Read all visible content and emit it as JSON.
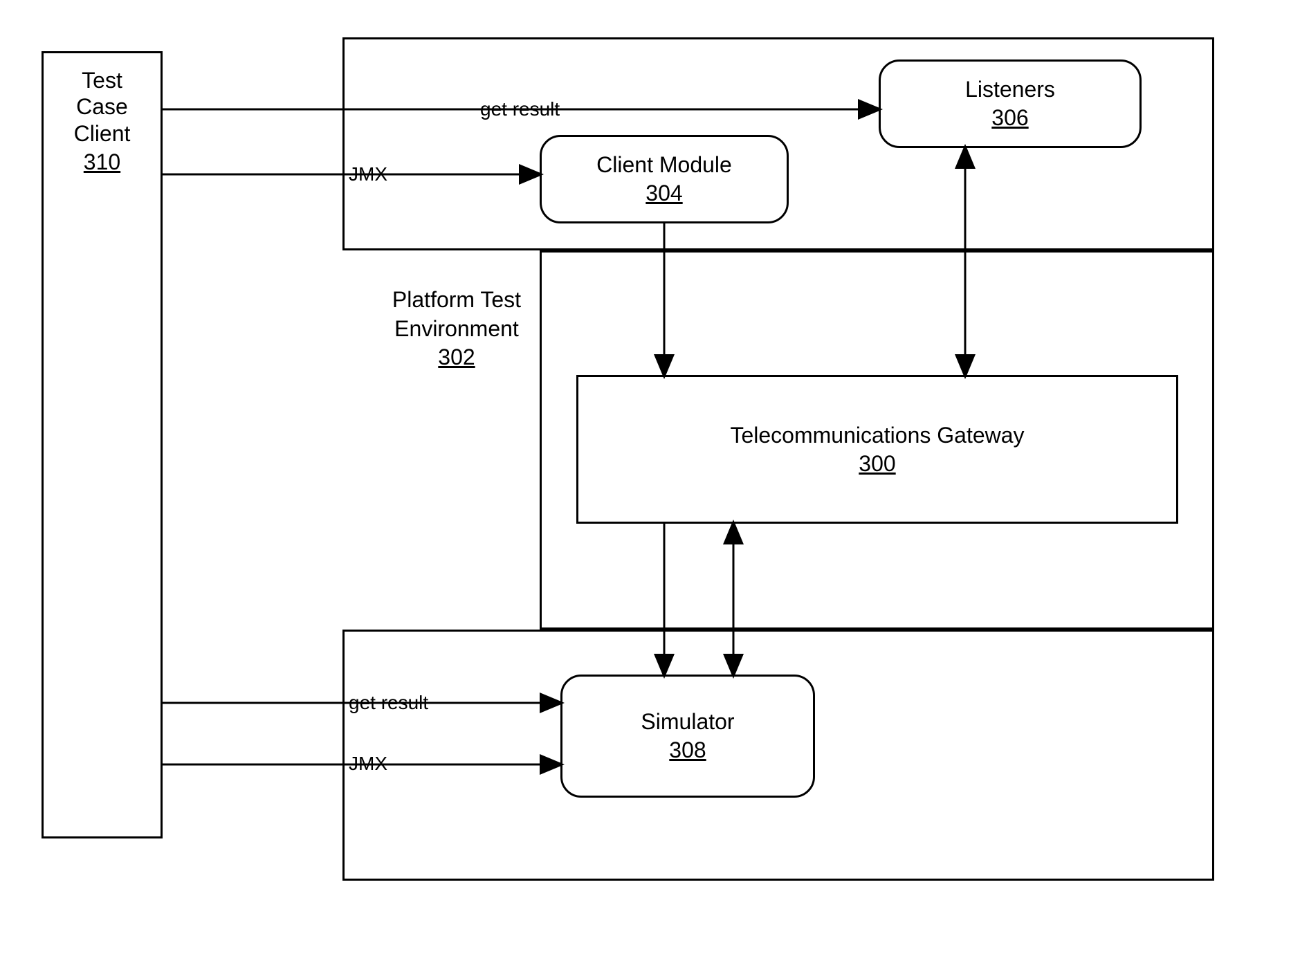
{
  "nodes": {
    "test_case_client": {
      "title": "Test\nCase\nClient",
      "ref": "310"
    },
    "platform_test_env": {
      "title": "Platform Test\nEnvironment",
      "ref": "302"
    },
    "listeners": {
      "title": "Listeners",
      "ref": "306"
    },
    "client_module": {
      "title": "Client Module",
      "ref": "304"
    },
    "telecom_gateway": {
      "title": "Telecommunications Gateway",
      "ref": "300"
    },
    "simulator": {
      "title": "Simulator",
      "ref": "308"
    }
  },
  "edges": {
    "get_result_top": "get result",
    "jmx_top": "JMX",
    "get_result_bottom": "get result",
    "jmx_bottom": "JMX"
  }
}
